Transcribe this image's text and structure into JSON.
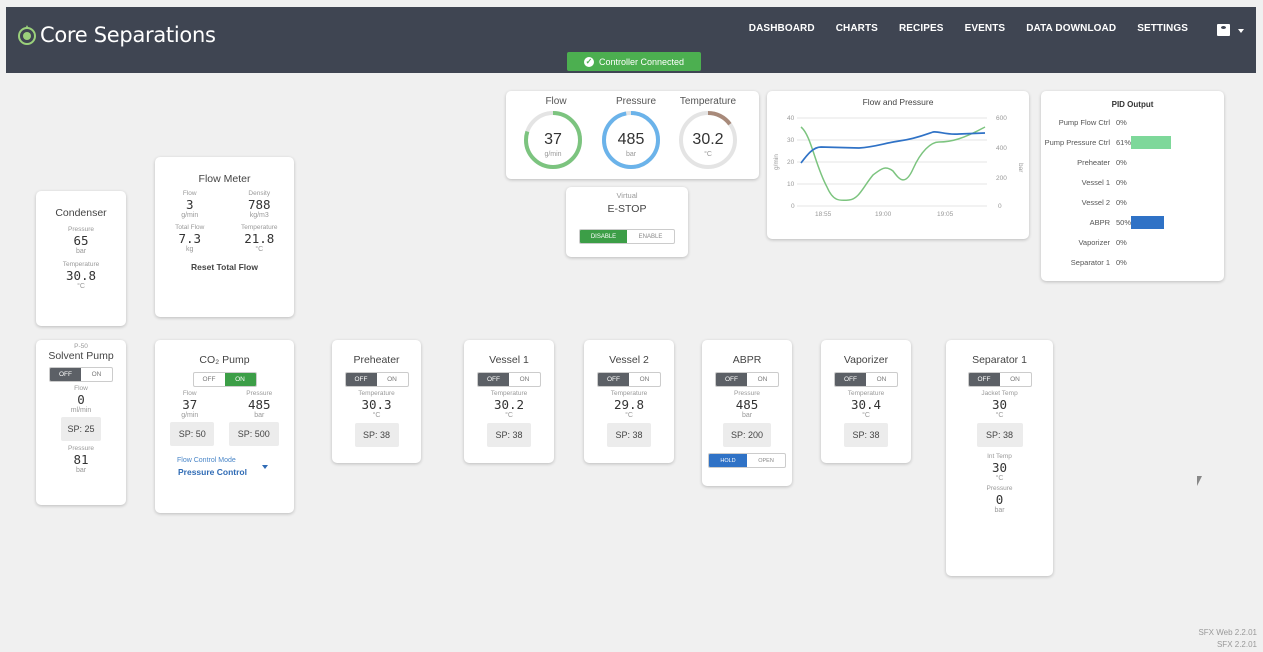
{
  "app": {
    "brand": "Core Separations",
    "status": "Controller Connected"
  },
  "nav": [
    "DASHBOARD",
    "CHARTS",
    "RECIPES",
    "EVENTS",
    "DATA DOWNLOAD",
    "SETTINGS"
  ],
  "gauges": [
    {
      "label": "Flow",
      "value": "37",
      "unit": "g/min",
      "color": "#7cc47f",
      "fill": 0.8
    },
    {
      "label": "Pressure",
      "value": "485",
      "unit": "bar",
      "color": "#6bb3ea",
      "fill": 0.97
    },
    {
      "label": "Temperature",
      "value": "30.2",
      "unit": "°C",
      "color": "#a88a7a",
      "fill": 0.15
    }
  ],
  "estop": {
    "label1": "Virtual",
    "label2": "E-STOP",
    "disable": "DISABLE",
    "enable": "ENABLE"
  },
  "flowpress": {
    "title": "Flow and Pressure",
    "yleft": [
      "40",
      "30",
      "20",
      "10",
      "0"
    ],
    "yright": [
      "600",
      "400",
      "200",
      "0"
    ],
    "xticks": [
      "18:55",
      "19:00",
      "19:05"
    ],
    "yleftlabel": "g/min",
    "yrightlabel": "bar"
  },
  "pid": {
    "title": "PID Output",
    "rows": [
      {
        "name": "Pump Flow Ctrl",
        "value": "0%",
        "pct": 0,
        "color": "#7ed89a"
      },
      {
        "name": "Pump Pressure Ctrl",
        "value": "61%",
        "pct": 0.61,
        "color": "#7ed89a"
      },
      {
        "name": "Preheater",
        "value": "0%",
        "pct": 0,
        "color": "#7ed89a"
      },
      {
        "name": "Vessel 1",
        "value": "0%",
        "pct": 0,
        "color": "#7ed89a"
      },
      {
        "name": "Vessel 2",
        "value": "0%",
        "pct": 0,
        "color": "#7ed89a"
      },
      {
        "name": "ABPR",
        "value": "50%",
        "pct": 0.5,
        "color": "#2f72c6"
      },
      {
        "name": "Vaporizer",
        "value": "0%",
        "pct": 0,
        "color": "#7ed89a"
      },
      {
        "name": "Separator 1",
        "value": "0%",
        "pct": 0,
        "color": "#7ed89a"
      }
    ]
  },
  "condenser": {
    "title": "Condenser",
    "p_label": "Pressure",
    "p_value": "65",
    "p_unit": "bar",
    "t_label": "Temperature",
    "t_value": "30.8",
    "t_unit": "°C"
  },
  "flowmeter": {
    "title": "Flow Meter",
    "flow_label": "Flow",
    "flow_value": "3",
    "flow_unit": "g/min",
    "density_label": "Density",
    "density_value": "788",
    "density_unit": "kg/m3",
    "total_label": "Total Flow",
    "total_value": "7.3",
    "total_unit": "kg",
    "temp_label": "Temperature",
    "temp_value": "21.8",
    "temp_unit": "°C",
    "reset": "Reset Total Flow"
  },
  "solvent": {
    "small": "P-50",
    "title": "Solvent Pump",
    "off": "OFF",
    "on": "ON",
    "flow_label": "Flow",
    "flow_value": "0",
    "flow_unit": "ml/min",
    "sp": "SP: 25",
    "p_label": "Pressure",
    "p_value": "81",
    "p_unit": "bar"
  },
  "co2": {
    "title": "CO₂ Pump",
    "off": "OFF",
    "on": "ON",
    "flow_label": "Flow",
    "flow_value": "37",
    "flow_unit": "g/min",
    "p_label": "Pressure",
    "p_value": "485",
    "p_unit": "bar",
    "sp1": "SP: 50",
    "sp2": "SP: 500",
    "mode_label": "Flow Control Mode",
    "mode_value": "Pressure Control"
  },
  "units": [
    {
      "title": "Preheater",
      "label": "Temperature",
      "value": "30.3",
      "unit": "°C",
      "sp": "SP: 38"
    },
    {
      "title": "Vessel 1",
      "label": "Temperature",
      "value": "30.2",
      "unit": "°C",
      "sp": "SP: 38"
    },
    {
      "title": "Vessel 2",
      "label": "Temperature",
      "value": "29.8",
      "unit": "°C",
      "sp": "SP: 38"
    },
    {
      "title": "ABPR",
      "label": "Pressure",
      "value": "485",
      "unit": "bar",
      "sp": "SP: 200"
    },
    {
      "title": "Vaporizer",
      "label": "Temperature",
      "value": "30.4",
      "unit": "°C",
      "sp": "SP: 38"
    }
  ],
  "toggle": {
    "off": "OFF",
    "on": "ON"
  },
  "abpr": {
    "hold": "HOLD",
    "open": "OPEN"
  },
  "separator": {
    "title": "Separator 1",
    "jt_label": "Jacket Temp",
    "jt_value": "30",
    "jt_unit": "°C",
    "sp": "SP: 38",
    "it_label": "Int Temp",
    "it_value": "30",
    "it_unit": "°C",
    "p_label": "Pressure",
    "p_value": "0",
    "p_unit": "bar"
  },
  "version": {
    "line1": "SFX Web 2.2.01",
    "line2": "SFX 2.2.01"
  }
}
